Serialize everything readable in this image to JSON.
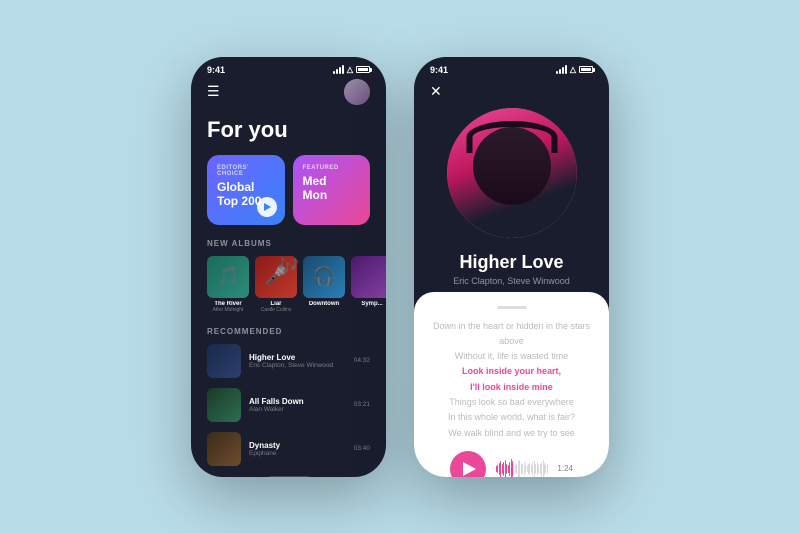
{
  "background": "#b8dce8",
  "phone1": {
    "status": {
      "time": "9:41"
    },
    "header": {
      "menu_icon": "☰",
      "avatar_alt": "user avatar"
    },
    "page_title": "For you",
    "section_editors": "EDITORS' CHOICE",
    "section_featured": "FEATURED",
    "card1": {
      "label": "EDITORS' CHOICE",
      "title": "Global\nTop 200"
    },
    "card2": {
      "label": "FEATURED",
      "title": "Med\nMon"
    },
    "section_new_albums": "NEW ALBUMS",
    "albums": [
      {
        "name": "The River",
        "artist": "After Midnight"
      },
      {
        "name": "Liar",
        "artist": "Castle Collins"
      },
      {
        "name": "Downtown",
        "artist": ""
      },
      {
        "name": "Symp...",
        "artist": ""
      }
    ],
    "section_recommended": "RECOMMENDED",
    "tracks": [
      {
        "title": "Higher Love",
        "artist": "Eric Clapton, Steve Winwood",
        "duration": "04:32"
      },
      {
        "title": "All Falls Down",
        "artist": "Alan Walker",
        "duration": "03:21"
      },
      {
        "title": "Dynasty",
        "artist": "Epiphane",
        "duration": "03:40"
      }
    ]
  },
  "phone2": {
    "status": {
      "time": "9:41"
    },
    "close_btn": "✕",
    "song_title": "Higher Love",
    "song_artist": "Eric Clapton, Steve Winwood",
    "lyrics": [
      {
        "text": "Down in the heart or hidden in the stars above",
        "highlight": false
      },
      {
        "text": "Without it, life is wasted time",
        "highlight": false
      },
      {
        "text": "Look inside your heart,",
        "highlight": true
      },
      {
        "text": "I'll look inside mine",
        "highlight": true
      },
      {
        "text": "Things look so bad everywhere",
        "highlight": false
      },
      {
        "text": "In this whole world, what is fair?",
        "highlight": false
      },
      {
        "text": "We walk blind and we try to see",
        "highlight": false
      }
    ],
    "time": "1:24"
  }
}
